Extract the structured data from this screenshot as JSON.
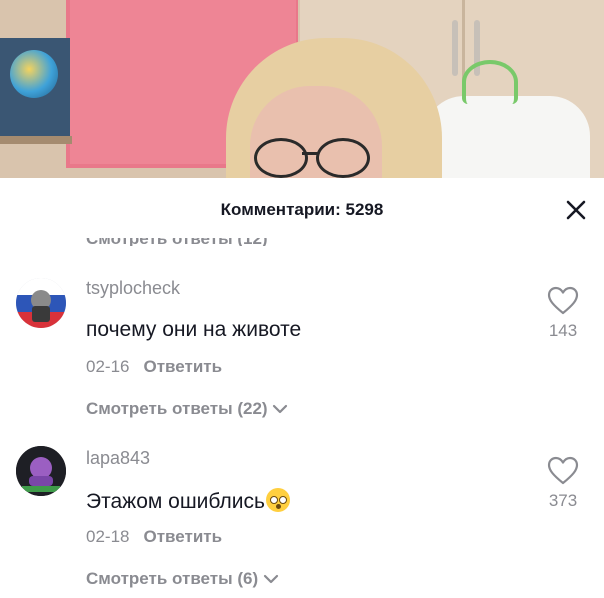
{
  "sheet": {
    "title": "Комментарии: 5298",
    "truncated_view_replies": "Смотреть ответы (12)"
  },
  "comments": [
    {
      "username": "tsyplocheck",
      "text": "почему они на животе",
      "date": "02-16",
      "reply_label": "Ответить",
      "view_replies": "Смотреть ответы (22)",
      "likes": "143"
    },
    {
      "username": "lapa843",
      "text": "Этажом ошиблись",
      "emoji": "flushed-face",
      "date": "02-18",
      "reply_label": "Ответить",
      "view_replies": "Смотреть ответы (6)",
      "likes": "373"
    }
  ],
  "icons": {
    "close": "close-icon",
    "like": "heart-outline-icon",
    "expand": "chevron-down-icon"
  },
  "colors": {
    "text_primary": "#161823",
    "text_secondary": "#8a8b91",
    "background": "#ffffff"
  }
}
